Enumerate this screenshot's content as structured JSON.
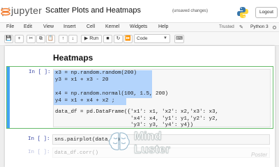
{
  "header": {
    "logo_text": "jupyter",
    "notebook_title": "Scatter Plots and Heatmaps",
    "save_status": "(unsaved changes)",
    "logout_label": "Logout"
  },
  "menu": {
    "items": [
      "File",
      "Edit",
      "View",
      "Insert",
      "Cell",
      "Kernel",
      "Widgets",
      "Help"
    ],
    "trusted_label": "Trusted",
    "kernel_label": "Python 3"
  },
  "toolbar": {
    "run_label": "Run",
    "cell_type": "Code"
  },
  "notebook": {
    "heading": "Heatmaps",
    "cells": [
      {
        "prompt": "In [ ]:",
        "lines": [
          "x3 = np.random.random(200)",
          "y3 = x1 + x3 - 20",
          "",
          "x4 = np.random.normal(100, 1.5, 200)",
          "y4 = x1 + x4 + x2 ;",
          "",
          "data_df = pd.DataFrame({'x1': x1, 'x2': x2,'x3': x3,",
          "                        'x4': x4, 'y1': y1,'y2': y2,",
          "                        'y3': y3, 'y4': y4})"
        ]
      },
      {
        "prompt": "In [ ]:",
        "code": "sns.pairplot(data_df)"
      },
      {
        "prompt": "In [ ]:",
        "code": "data_df.corr()"
      }
    ]
  },
  "watermark": {
    "line1": "Mind",
    "line2": "Luster",
    "small": "Poster"
  },
  "colors": {
    "jupyter_orange": "#f37726",
    "selection": "#b3d4fc",
    "prompt": "#303f9f",
    "selected_border": "#66bb6a",
    "selected_bar": "#42a5f5"
  }
}
